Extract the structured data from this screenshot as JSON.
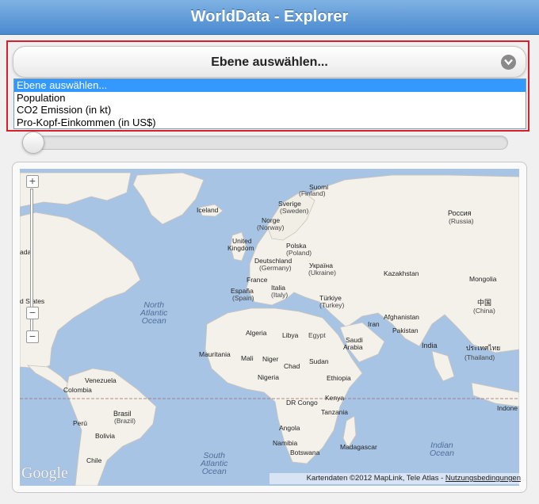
{
  "header": {
    "title": "WorldData - Explorer"
  },
  "layer_select": {
    "label": "Ebene auswählen...",
    "options": [
      "Ebene auswählen...",
      "Population",
      "CO2 Emission (in kt)",
      "Pro-Kopf-Einkommen (in US$)"
    ]
  },
  "slider": {
    "value_fraction": 0
  },
  "map": {
    "zoom_in": "+",
    "zoom_out": "−",
    "logo": "Google",
    "attribution": "Kartendaten ©2012 MapLink, Tele Atlas - ",
    "terms_link": "Nutzungsbedingungen",
    "labels": [
      {
        "t": "Suomi"
      },
      {
        "t": "(Finland)"
      },
      {
        "t": "Sverige"
      },
      {
        "t": "(Sweden)"
      },
      {
        "t": "Iceland"
      },
      {
        "t": "Norge"
      },
      {
        "t": "(Norway)"
      },
      {
        "t": "Россия"
      },
      {
        "t": "(Russia)"
      },
      {
        "t": "United"
      },
      {
        "t": "Kingdom"
      },
      {
        "t": "Polska"
      },
      {
        "t": "(Poland)"
      },
      {
        "t": "Deutschland"
      },
      {
        "t": "(Germany)"
      },
      {
        "t": "Україна"
      },
      {
        "t": "(Ukraine)"
      },
      {
        "t": "Kazakhstan"
      },
      {
        "t": "Mongolia"
      },
      {
        "t": "France"
      },
      {
        "t": "España"
      },
      {
        "t": "(Spain)"
      },
      {
        "t": "Italia"
      },
      {
        "t": "(Italy)"
      },
      {
        "t": "Türkiye"
      },
      {
        "t": "(Turkey)"
      },
      {
        "t": "中国"
      },
      {
        "t": "(China)"
      },
      {
        "t": "Afghanistan"
      },
      {
        "t": "Iran"
      },
      {
        "t": "Algeria"
      },
      {
        "t": "Libya"
      },
      {
        "t": "Egypt"
      },
      {
        "t": "Saudi"
      },
      {
        "t": "Arabia"
      },
      {
        "t": "India"
      },
      {
        "t": "ประเทศไทย"
      },
      {
        "t": "(Thailand)"
      },
      {
        "t": "Pakistan"
      },
      {
        "t": "Mauritania"
      },
      {
        "t": "Mali"
      },
      {
        "t": "Niger"
      },
      {
        "t": "Chad"
      },
      {
        "t": "Sudan"
      },
      {
        "t": "Nigeria"
      },
      {
        "t": "Ethiopia"
      },
      {
        "t": "Venezuela"
      },
      {
        "t": "Colombia"
      },
      {
        "t": "Kenya"
      },
      {
        "t": "DR Congo"
      },
      {
        "t": "Tanzania"
      },
      {
        "t": "Brasil"
      },
      {
        "t": "(Brazil)"
      },
      {
        "t": "Perú"
      },
      {
        "t": "Bolivia"
      },
      {
        "t": "Angola"
      },
      {
        "t": "Namibia"
      },
      {
        "t": "Botswana"
      },
      {
        "t": "Madagascar"
      },
      {
        "t": "Chile"
      },
      {
        "t": "Indone"
      },
      {
        "t": "ada"
      },
      {
        "t": "d States"
      }
    ],
    "oceans": [
      {
        "t": "North\nAtlantic\nOcean"
      },
      {
        "t": "South\nAtlantic\nOcean"
      },
      {
        "t": "Indian\nOcean"
      }
    ]
  }
}
